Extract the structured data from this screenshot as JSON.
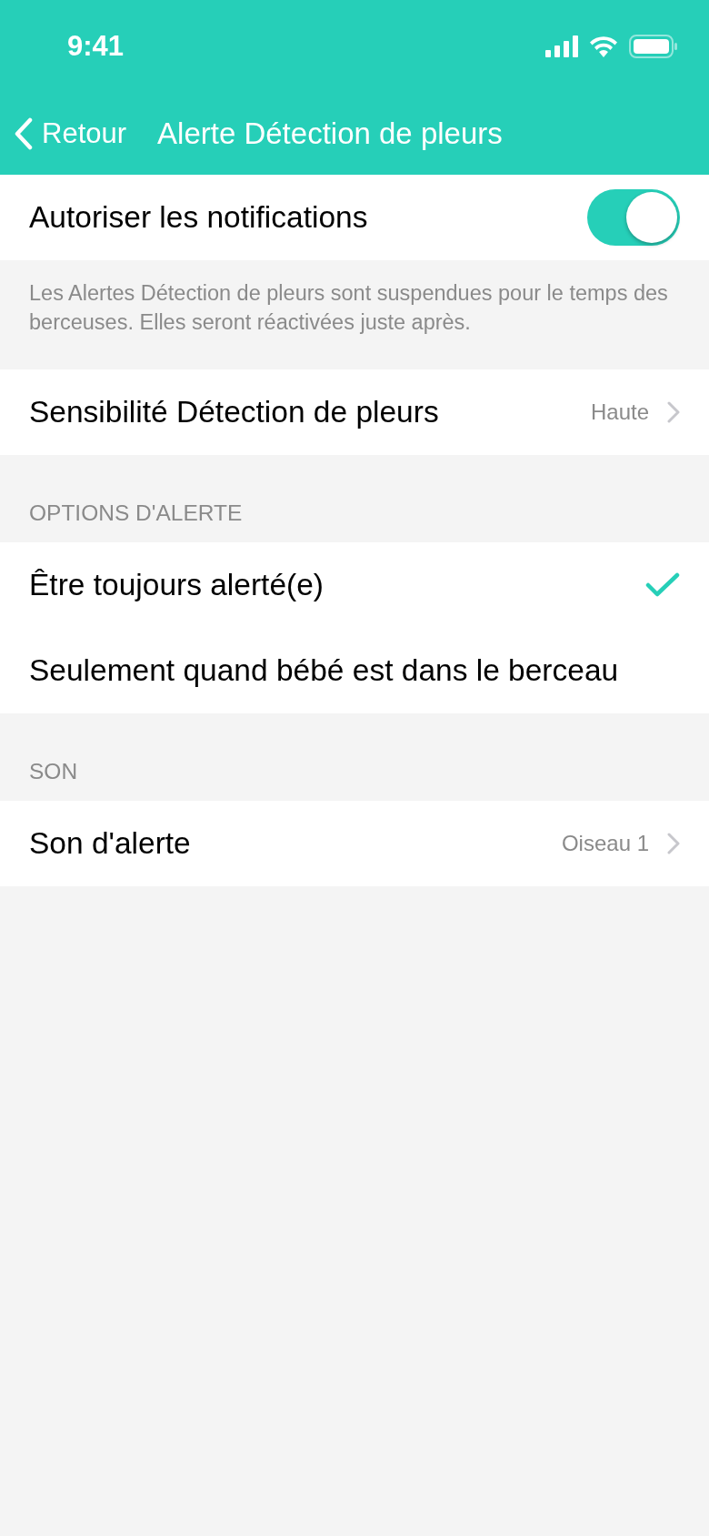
{
  "status_bar": {
    "time": "9:41"
  },
  "nav_bar": {
    "back": "Retour",
    "title": "Alerte Détection de pleurs"
  },
  "notifications": {
    "label": "Autoriser les notifications",
    "on": true,
    "footer": "Les Alertes Détection de pleurs sont suspendues pour le temps des berceuses. Elles seront réactivées juste après."
  },
  "sensitivity": {
    "label": "Sensibilité Détection de pleurs",
    "value": "Haute"
  },
  "alert_options": {
    "header": "OPTIONS D'ALERTE",
    "options": [
      {
        "label": "Être toujours alerté(e)",
        "selected": true
      },
      {
        "label": "Seulement quand bébé est dans le berceau",
        "selected": false
      }
    ]
  },
  "sound": {
    "header": "SON",
    "label": "Son d'alerte",
    "value": "Oiseau 1"
  }
}
